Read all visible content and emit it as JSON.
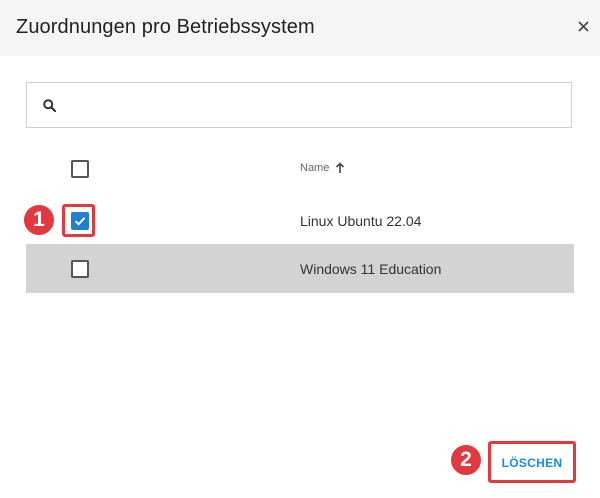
{
  "dialog": {
    "title": "Zuordnungen pro Betriebssystem",
    "close_icon": "close-icon"
  },
  "search": {
    "icon": "search-icon",
    "value": "",
    "placeholder": ""
  },
  "table": {
    "columns": [
      {
        "label": "Name",
        "sort": "ascending",
        "sort_icon": "arrow-up-icon"
      }
    ],
    "select_all_checked": false,
    "rows": [
      {
        "name": "Linux Ubuntu 22.04",
        "checked": true
      },
      {
        "name": "Windows 11 Education",
        "checked": false,
        "highlighted": true
      }
    ]
  },
  "actions": {
    "delete_label": "LÖSCHEN"
  },
  "annotations": {
    "step1": "1",
    "step2": "2"
  },
  "colors": {
    "accent": "#1e7fd6",
    "button_text": "#1a8cd8",
    "annotation": "#e03a3e",
    "row_highlight": "#d3d3d3",
    "header_bg": "#f5f5f5"
  }
}
